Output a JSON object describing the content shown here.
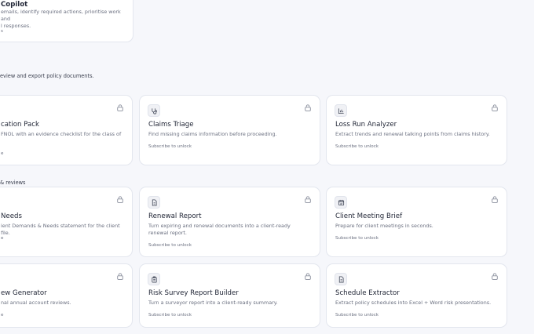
{
  "top_card": {
    "title": "Copilot",
    "desc_line1": "emails, identify required actions, prioritise work and",
    "desc_line2": "l responses.",
    "sub": "s"
  },
  "section1": {
    "text": "eview and export policy documents."
  },
  "section2": {
    "text": "& reviews"
  },
  "row1": [
    {
      "title": "cation Pack",
      "desc": "FNOL with an evidence checklist for the class of",
      "sub": "e",
      "icon": ""
    },
    {
      "title": "Claims Triage",
      "desc": "Find missing claims information before proceeding.",
      "sub": "Subscribe to unlock",
      "icon": "stethoscope-icon"
    },
    {
      "title": "Loss Run Analyzer",
      "desc": "Extract trends and renewal talking points from claims history.",
      "sub": "Subscribe to unlock",
      "icon": "bar-chart-icon"
    }
  ],
  "row2": [
    {
      "title": "Needs",
      "desc": "ient Demands & Needs statement for the client file.",
      "sub": "e",
      "icon": ""
    },
    {
      "title": "Renewal Report",
      "desc": "Turn expiring and renewal documents into a client-ready renewal report.",
      "sub": "Subscribe to unlock",
      "icon": "file-text-icon"
    },
    {
      "title": "Client Meeting Brief",
      "desc": "Prepare for client meetings in seconds.",
      "sub": "Subscribe to unlock",
      "icon": "calendar-icon"
    }
  ],
  "row3": [
    {
      "title": "ew Generator",
      "desc": "nal annual account reviews.",
      "sub": "e",
      "icon": ""
    },
    {
      "title": "Risk Survey Report Builder",
      "desc": "Turn a surveyor report into a client-ready summary.",
      "sub": "Subscribe to unlock",
      "icon": "clipboard-icon"
    },
    {
      "title": "Schedule Extractor",
      "desc": "Extract policy schedules into Excel + Word risk presentations.",
      "sub": "Subscribe to unlock",
      "icon": "file-text-icon"
    }
  ],
  "colors": {
    "background": "#f6f7fb",
    "card": "#ffffff",
    "border": "#e3e6ee",
    "text": "#232838",
    "muted": "#6b7080"
  }
}
